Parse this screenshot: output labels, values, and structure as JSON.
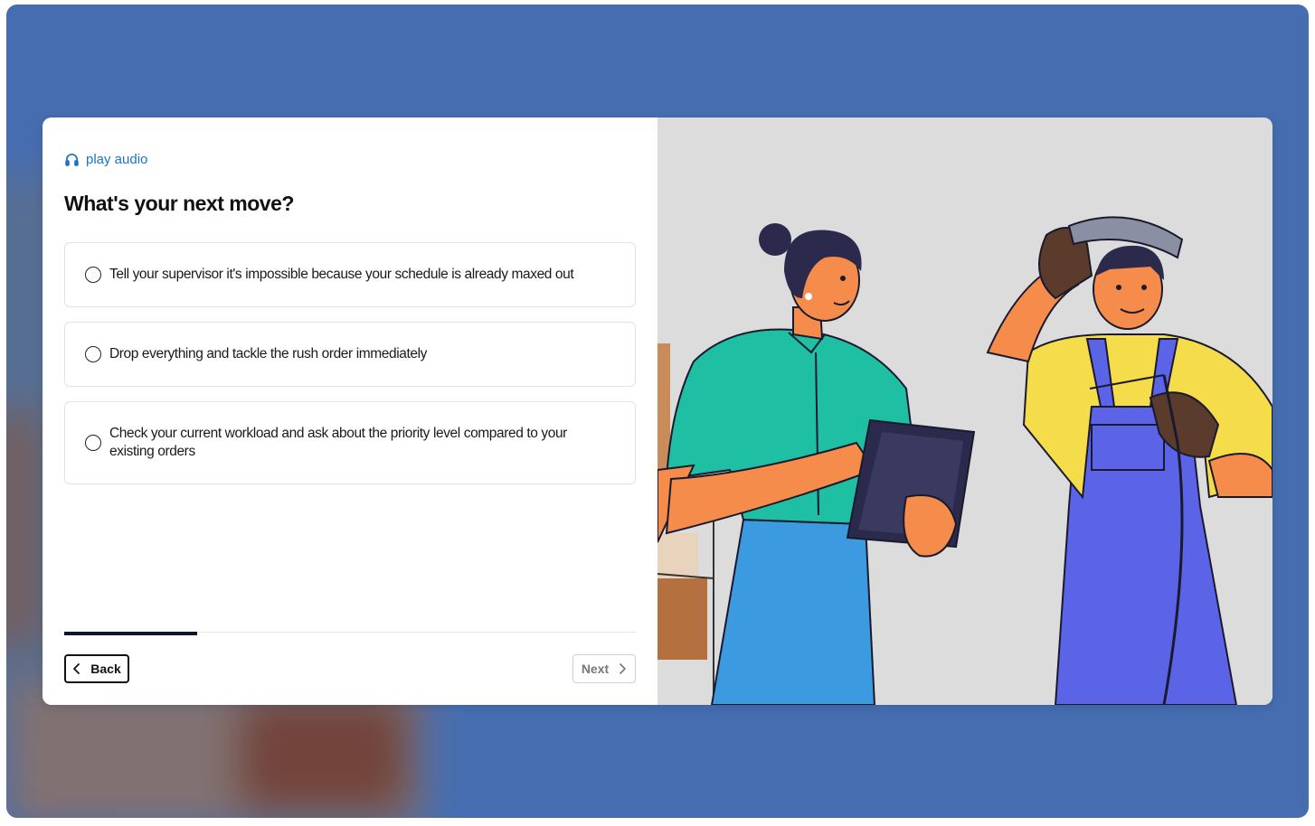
{
  "audio": {
    "label": "play audio",
    "icon": "headphones-icon"
  },
  "question": {
    "title": "What's your next move?"
  },
  "options": [
    {
      "label": "Tell your supervisor it's impossible because your schedule is already maxed out"
    },
    {
      "label": "Drop everything and tackle the rush order immediately"
    },
    {
      "label": "Check your current workload and ask about the priority level compared to your existing orders"
    }
  ],
  "progress": {
    "fraction": 0.233
  },
  "navigation": {
    "back_label": "Back",
    "next_label": "Next"
  },
  "colors": {
    "backdrop": "#466db0",
    "accent": "#1a73c8",
    "progress": "#0f1730"
  }
}
